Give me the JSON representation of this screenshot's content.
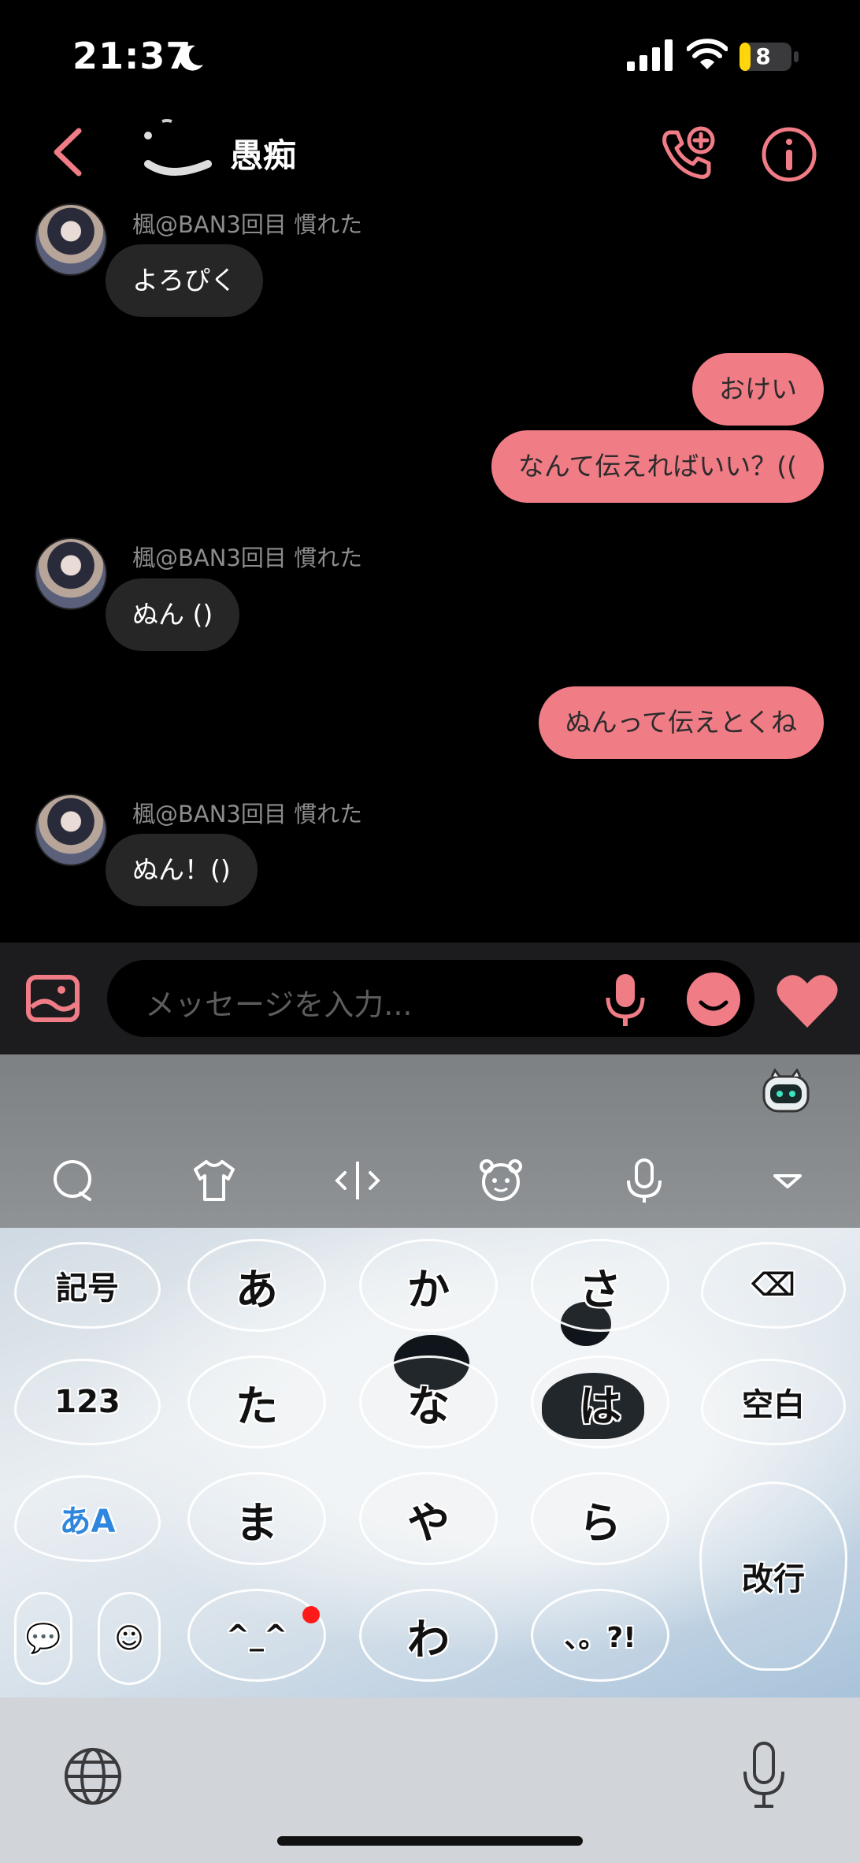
{
  "status_bar": {
    "time": "21:37",
    "battery": "8"
  },
  "header": {
    "title": "愚痴"
  },
  "messages": [
    {
      "direction": "in",
      "sender": "楓@BAN3回目 慣れた",
      "text": "よろぴく"
    },
    {
      "direction": "out",
      "text": "おけい"
    },
    {
      "direction": "out",
      "text": "なんて伝えればいい？(("
    },
    {
      "direction": "in",
      "sender": "楓@BAN3回目 慣れた",
      "text": "ぬん ()"
    },
    {
      "direction": "out",
      "text": "ぬんって伝えとくね"
    },
    {
      "direction": "in",
      "sender": "楓@BAN3回目 慣れた",
      "text": "ぬん！()"
    }
  ],
  "composer": {
    "placeholder": "メッセージを入力..."
  },
  "keyboard": {
    "rows": [
      [
        "記号",
        "あ",
        "か",
        "さ",
        "⌫"
      ],
      [
        "123",
        "た",
        "な",
        "は",
        "空白"
      ],
      [
        "あA",
        "ま",
        "や",
        "ら",
        "改行"
      ],
      [
        "💬",
        "☺",
        "^_^",
        "わ",
        "、。?!"
      ]
    ],
    "toolbar": [
      "search-bubble-icon",
      "shirt-icon",
      "cursor-icon",
      "bear-face-icon",
      "mic-icon",
      "collapse-icon"
    ]
  },
  "colors": {
    "accent": "#f07c86",
    "incoming_bubble": "#262626",
    "background": "#000000"
  }
}
